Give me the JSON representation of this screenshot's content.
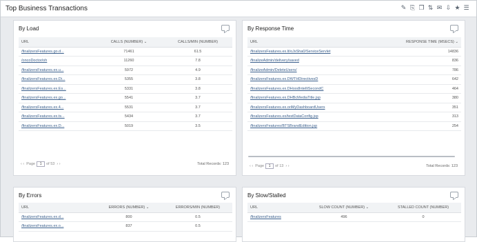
{
  "app": {
    "title": "Top Business Transactions"
  },
  "toolbar": [
    "✎",
    "⎘",
    "❐",
    "⇅",
    "✉",
    "⇩",
    "★",
    "☰"
  ],
  "by_load": {
    "title": "By Load",
    "headers": [
      "URL",
      "CALLS (NUMBER) ⌄",
      "CALLS/MIN (NUMBER)"
    ],
    "rows": [
      [
        "/finalizersFeatures.go.d...",
        "71461",
        "61.5"
      ],
      [
        "/oncoDoctor/oh",
        "11260",
        "7.8"
      ],
      [
        "/finalizersFeatures.ex.u...",
        "5972",
        "4.9"
      ],
      [
        "/finalizersFeatures.ex.Di...",
        "5355",
        "3.8"
      ],
      [
        "/finalizersFeatures.ex.Es...",
        "5331",
        "3.8"
      ],
      [
        "/finalizersFeatures.ex.go...",
        "5541",
        "3.7"
      ],
      [
        "/finalizersFeatures.ex.4...",
        "5531",
        "3.7"
      ],
      [
        "/finalizersFeatures.ex.ts...",
        "5434",
        "3.7"
      ],
      [
        "/finalizersFeatures.ex.D...",
        "5019",
        "3.5"
      ]
    ],
    "pager": {
      "prev": "‹ ‹",
      "page_label": "Page",
      "page": "1",
      "of": "of 53",
      "next": "› ›"
    },
    "total": "Total Records: 123"
  },
  "by_response": {
    "title": "By Response Time",
    "headers": [
      "URL",
      "RESPONSE TIME (MSECS) ⌄"
    ],
    "rows": [
      [
        "/finalizersFeatures.ex.lt/oJsSha0/ServiceServlet",
        "14836"
      ],
      [
        "/finalizeAdmin/delivery/saved",
        "836"
      ],
      [
        "/finalizeAdmin/DeleteUsers/",
        "786"
      ],
      [
        "/finalizersFeatures.ex.DWTHDirectivesD",
        "642"
      ],
      [
        "/finalizersFeatures.ex.DHoodIntelliSecondC",
        "464"
      ],
      [
        "/finalizersFeatures.ex.DHBcMediaTitle.jsp",
        "380"
      ],
      [
        "/finalizersFeatures.ex.oriMyDashboardUsers",
        "351"
      ],
      [
        "/finalizersFeatures.ex/testDataConfig.jsp",
        "313"
      ],
      [
        "/finalizersFeatures/BTSBrandEdition.jsp",
        "254"
      ]
    ],
    "pager": {
      "prev": "‹ ‹",
      "page_label": "Page",
      "page": "1",
      "of": "of 13",
      "next": "› ›"
    },
    "total": "Total Records: 123"
  },
  "by_errors": {
    "title": "By Errors",
    "headers": [
      "URL",
      "ERRORS (NUMBER) ⌄",
      "ERRORS/MIN (NUMBER)"
    ],
    "rows": [
      [
        "/finalizersFeatures.ex.d...",
        "800",
        "0.5"
      ],
      [
        "/finalizersFeatures.ex.o...",
        "837",
        "0.5"
      ]
    ]
  },
  "by_slow": {
    "title": "By Slow/Stalled",
    "headers": [
      "URL",
      "SLOW COUNT (NUMBER) ⌄",
      "STALLED COUNT (NUMBER)"
    ],
    "rows": [
      [
        "/finalizersFeatures",
        "496",
        "0"
      ]
    ]
  }
}
